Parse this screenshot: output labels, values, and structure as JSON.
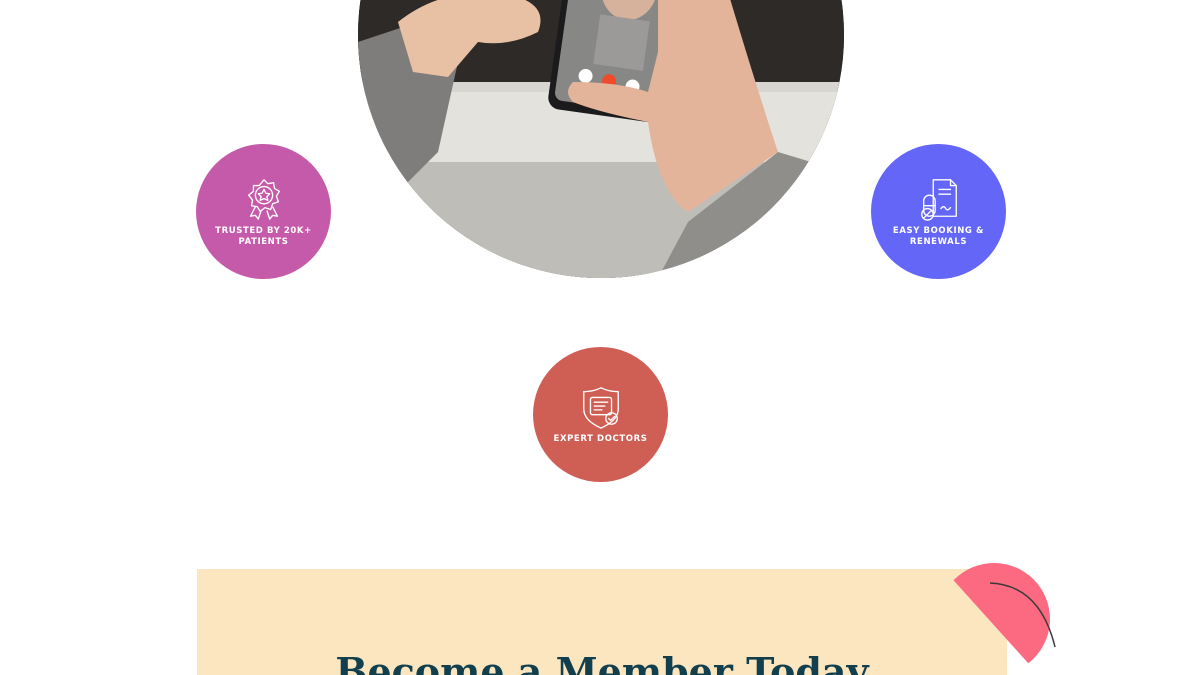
{
  "hero": {
    "image_alt": "Person holding a smartphone during a video call with a doctor"
  },
  "features": [
    {
      "label": "TRUSTED BY 20K+ PATIENTS",
      "icon": "award-badge-icon",
      "color": "#c65aaa"
    },
    {
      "label": "EASY BOOKING & RENEWALS",
      "icon": "prescription-document-icon",
      "color": "#6466f7"
    },
    {
      "label": "EXPERT DOCTORS",
      "icon": "medical-shield-icon",
      "color": "#cf5f55"
    }
  ],
  "membership": {
    "title": "Become a Member Today"
  },
  "colors": {
    "banner_bg": "#fbe6bf",
    "title": "#113f4e",
    "decoration": "#fb6a80"
  }
}
